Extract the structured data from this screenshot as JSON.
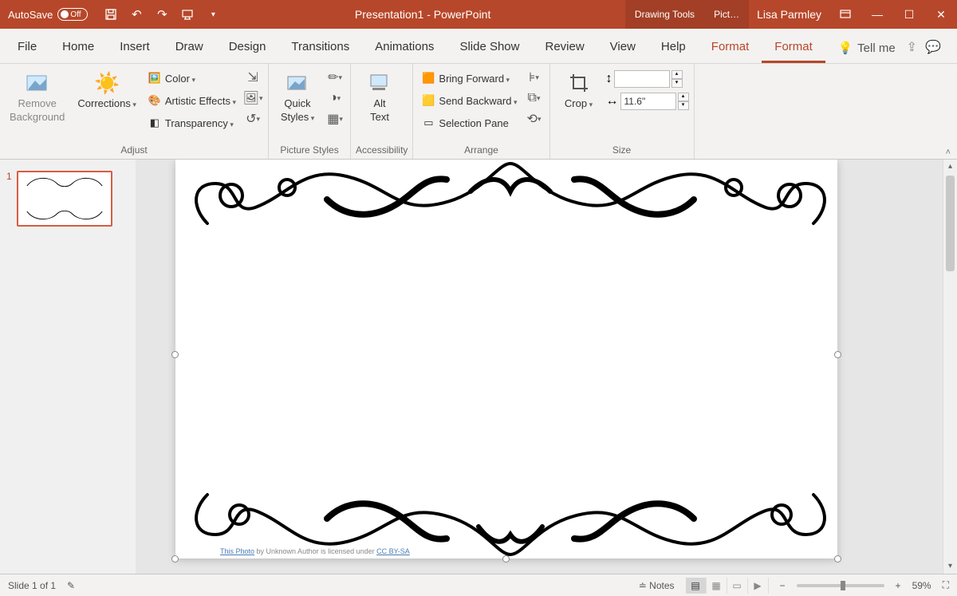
{
  "titlebar": {
    "autosave_label": "AutoSave",
    "autosave_state": "Off",
    "doc_title": "Presentation1  -  PowerPoint",
    "ctx_drawing": "Drawing Tools",
    "ctx_picture": "Pict…",
    "user": "Lisa Parmley"
  },
  "tabs": {
    "file": "File",
    "home": "Home",
    "insert": "Insert",
    "draw": "Draw",
    "design": "Design",
    "transitions": "Transitions",
    "animations": "Animations",
    "slideshow": "Slide Show",
    "review": "Review",
    "view": "View",
    "help": "Help",
    "format1": "Format",
    "format2": "Format",
    "tellme": "Tell me"
  },
  "ribbon": {
    "adjust": {
      "remove_bg": "Remove",
      "remove_bg2": "Background",
      "corrections": "Corrections",
      "color": "Color",
      "artistic": "Artistic Effects",
      "transparency": "Transparency",
      "label": "Adjust"
    },
    "pstyles": {
      "quick": "Quick",
      "quick2": "Styles",
      "label": "Picture Styles"
    },
    "access": {
      "alt": "Alt",
      "alt2": "Text",
      "label": "Accessibility"
    },
    "arrange": {
      "forward": "Bring Forward",
      "backward": "Send Backward",
      "selpane": "Selection Pane",
      "label": "Arrange"
    },
    "size": {
      "crop": "Crop",
      "height": "",
      "width": "11.6\"",
      "label": "Size"
    }
  },
  "canvas": {
    "slide_num": "1",
    "caption_prefix": "This Photo",
    "caption_mid": " by Unknown Author is licensed under ",
    "caption_link": "CC BY-SA"
  },
  "status": {
    "slide": "Slide 1 of 1",
    "notes": "Notes",
    "zoom": "59%"
  }
}
